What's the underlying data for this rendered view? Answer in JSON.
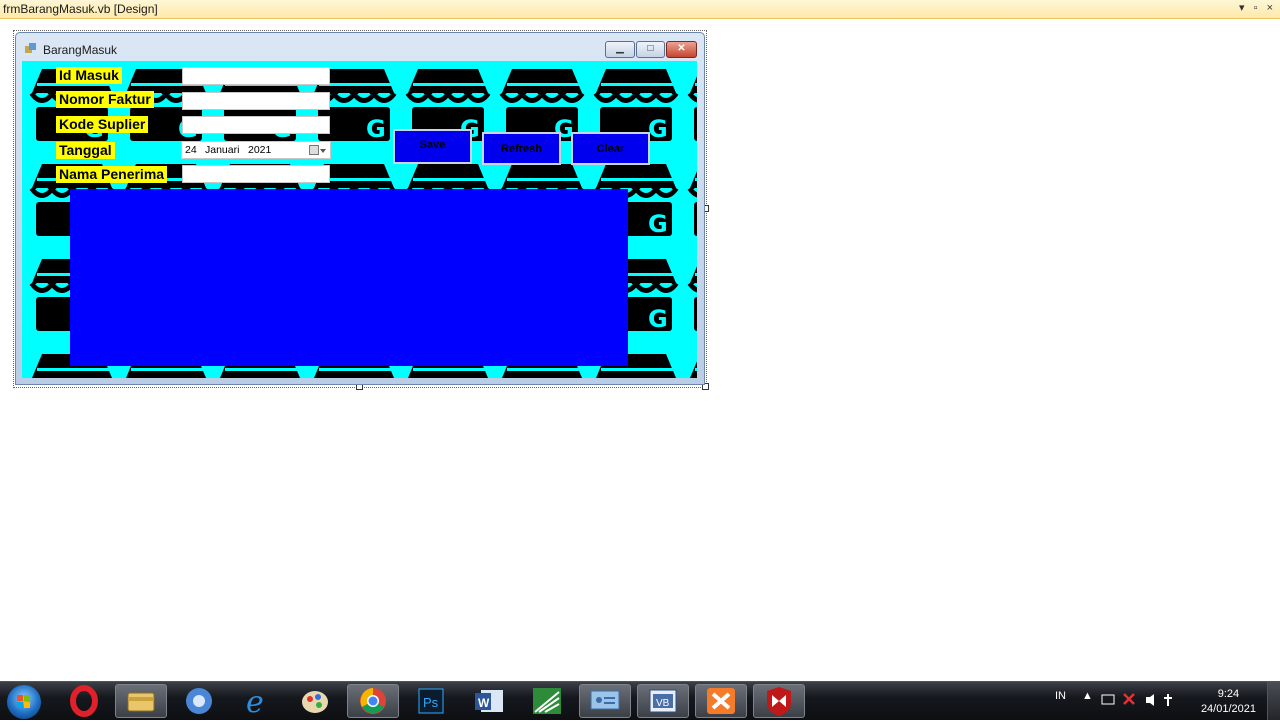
{
  "ide": {
    "doc_tab_title": "frmBarangMasuk.vb [Design]",
    "tab_controls": "▾ ▫ ×"
  },
  "form": {
    "title": "BarangMasuk",
    "labels": {
      "id_masuk": "Id Masuk",
      "nomor_faktur": "Nomor Faktur",
      "kode_suplier": "Kode Suplier",
      "tanggal": "Tanggal",
      "nama_penerima": "Nama Penerima"
    },
    "fields": {
      "id_masuk": "",
      "nomor_faktur": "",
      "kode_suplier": "",
      "nama_penerima": ""
    },
    "date": {
      "day": "24",
      "month": "Januari",
      "year": "2021"
    },
    "buttons": {
      "save": "Save",
      "refresh": "Refresh",
      "clear": "Clear"
    },
    "colors": {
      "background": "#00ffff",
      "label_bg": "#ffff00",
      "grid": "#0000ff",
      "button": "#0000ee"
    }
  },
  "taskbar": {
    "apps": [
      "opera-icon",
      "file-explorer-icon",
      "chromium-icon",
      "internet-explorer-icon",
      "paint-icon",
      "chrome-icon",
      "photoshop-icon",
      "word-icon",
      "sketchup-icon",
      "control-panel-icon",
      "visual-basic-icon",
      "xampp-icon",
      "mcafee-icon"
    ],
    "language": "IN",
    "time": "9:24",
    "date": "24/01/2021"
  }
}
